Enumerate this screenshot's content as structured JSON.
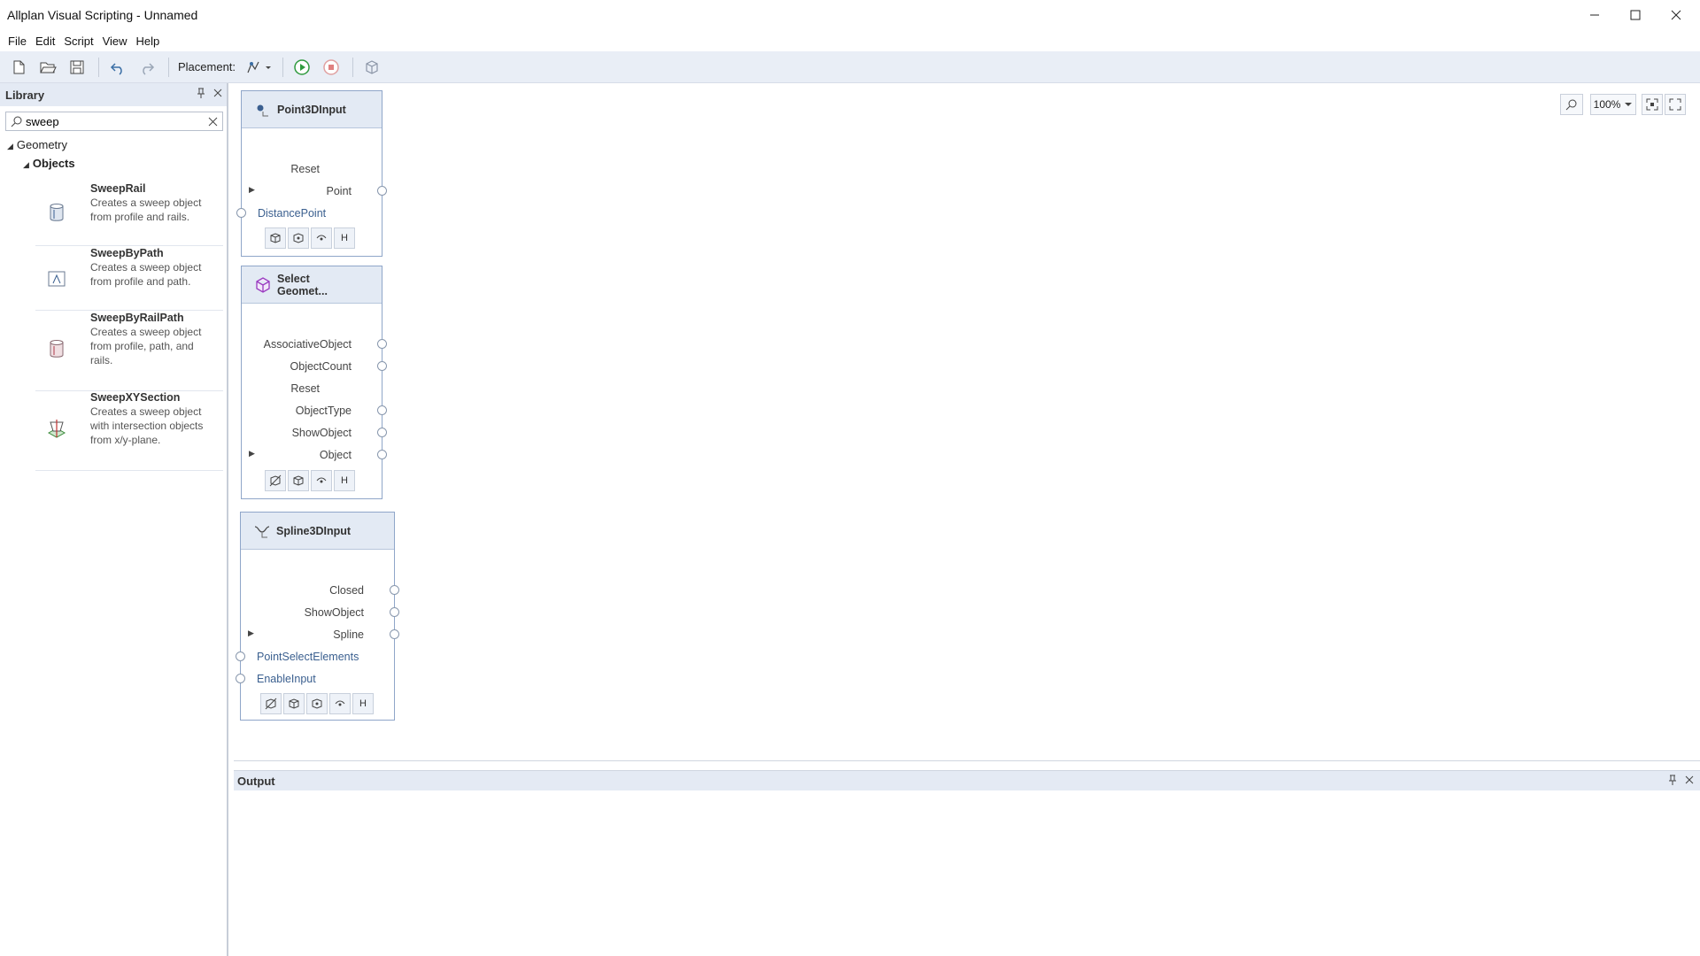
{
  "window": {
    "title": "Allplan Visual Scripting - Unnamed",
    "minimize": "—",
    "maximize": "☐",
    "close": "✕"
  },
  "menu": [
    "File",
    "Edit",
    "Script",
    "View",
    "Help"
  ],
  "toolbar": {
    "placement_label": "Placement:"
  },
  "library": {
    "title": "Library",
    "search_value": "sweep",
    "tree": {
      "category": "Geometry",
      "subcategory": "Objects"
    },
    "items": [
      {
        "name": "SweepRail",
        "desc": "Creates a sweep object from profile and rails."
      },
      {
        "name": "SweepByPath",
        "desc": "Creates a sweep object from profile and path."
      },
      {
        "name": "SweepByRailPath",
        "desc": "Creates a sweep object from profile, path, and rails."
      },
      {
        "name": "SweepXYSection",
        "desc": "Creates a sweep object with intersection objects from x/y-plane."
      }
    ]
  },
  "canvas": {
    "zoom": "100%"
  },
  "nodes": [
    {
      "title": "Point3DInput",
      "ports": [
        "Reset",
        "Point",
        "DistancePoint"
      ],
      "footer_h": "H"
    },
    {
      "title_line1": "Select",
      "title_line2": "Geomet...",
      "ports": [
        "AssociativeObject",
        "ObjectCount",
        "Reset",
        "ObjectType",
        "ShowObject",
        "Object"
      ],
      "footer_h": "H"
    },
    {
      "title": "Spline3DInput",
      "ports": [
        "Closed",
        "ShowObject",
        "Spline",
        "PointSelectElements",
        "EnableInput"
      ],
      "footer_h": "H"
    }
  ],
  "output": {
    "title": "Output"
  },
  "colors": {
    "toolbar_bg": "#e9eef6",
    "node_header": "#e3eaf4",
    "node_border": "#8fa6c9",
    "input_port_text": "#3a5f8f"
  }
}
